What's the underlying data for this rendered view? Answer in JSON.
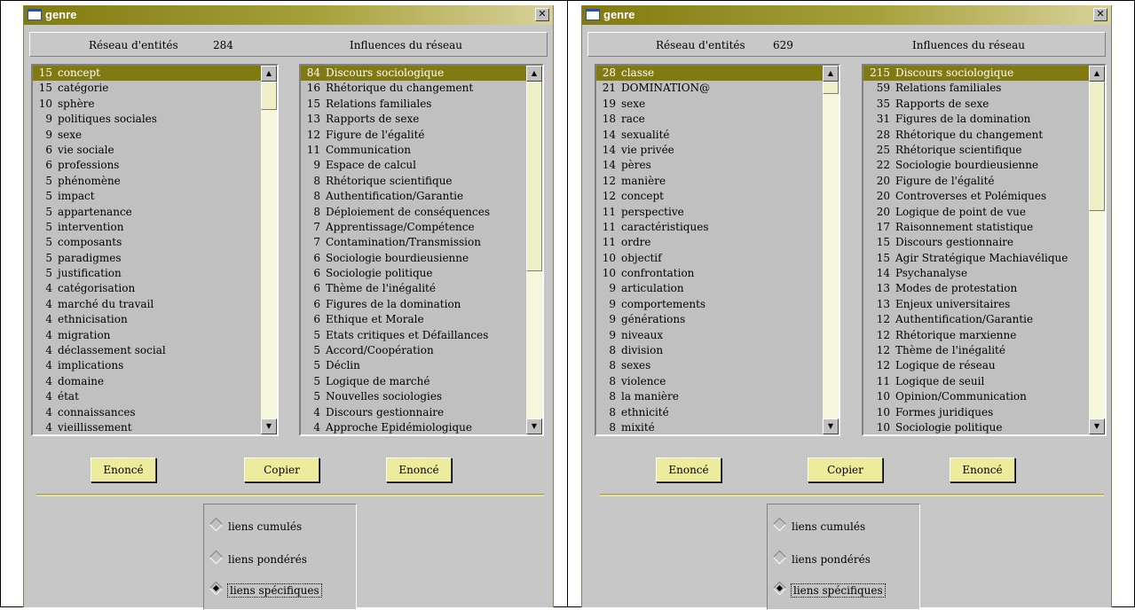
{
  "windows": [
    {
      "title": "genre",
      "close_glyph": "✕",
      "header": {
        "entities_label": "Réseau d'entités",
        "entities_count": "284",
        "influences_label": "Influences du réseau"
      },
      "left_list": [
        {
          "n": "15",
          "t": "concept"
        },
        {
          "n": "15",
          "t": "catégorie"
        },
        {
          "n": "10",
          "t": "sphère"
        },
        {
          "n": "9",
          "t": "politiques sociales"
        },
        {
          "n": "9",
          "t": "sexe"
        },
        {
          "n": "6",
          "t": "vie sociale"
        },
        {
          "n": "6",
          "t": "professions"
        },
        {
          "n": "5",
          "t": "phénomène"
        },
        {
          "n": "5",
          "t": "impact"
        },
        {
          "n": "5",
          "t": "appartenance"
        },
        {
          "n": "5",
          "t": "intervention"
        },
        {
          "n": "5",
          "t": "composants"
        },
        {
          "n": "5",
          "t": "paradigmes"
        },
        {
          "n": "5",
          "t": "justification"
        },
        {
          "n": "4",
          "t": "catégorisation"
        },
        {
          "n": "4",
          "t": "marché du travail"
        },
        {
          "n": "4",
          "t": "ethnicisation"
        },
        {
          "n": "4",
          "t": "migration"
        },
        {
          "n": "4",
          "t": "déclassement social"
        },
        {
          "n": "4",
          "t": "implications"
        },
        {
          "n": "4",
          "t": "domaine"
        },
        {
          "n": "4",
          "t": "état"
        },
        {
          "n": "4",
          "t": "connaissances"
        },
        {
          "n": "4",
          "t": "vieillissement"
        }
      ],
      "right_list": [
        {
          "n": "84",
          "t": "Discours sociologique"
        },
        {
          "n": "16",
          "t": "Rhétorique du changement"
        },
        {
          "n": "15",
          "t": "Relations familiales"
        },
        {
          "n": "13",
          "t": "Rapports de sexe"
        },
        {
          "n": "12",
          "t": "Figure de l'égalité"
        },
        {
          "n": "11",
          "t": "Communication"
        },
        {
          "n": "9",
          "t": "Espace de calcul"
        },
        {
          "n": "8",
          "t": "Rhétorique scientifique"
        },
        {
          "n": "8",
          "t": "Authentification/Garantie"
        },
        {
          "n": "8",
          "t": "Déploiement de conséquences"
        },
        {
          "n": "7",
          "t": "Apprentissage/Compétence"
        },
        {
          "n": "7",
          "t": "Contamination/Transmission"
        },
        {
          "n": "6",
          "t": "Sociologie bourdieusienne"
        },
        {
          "n": "6",
          "t": "Sociologie politique"
        },
        {
          "n": "6",
          "t": "Thème de l'inégalité"
        },
        {
          "n": "6",
          "t": "Figures de la domination"
        },
        {
          "n": "6",
          "t": "Ethique et Morale"
        },
        {
          "n": "5",
          "t": "Etats critiques et Défaillances"
        },
        {
          "n": "5",
          "t": "Accord/Coopération"
        },
        {
          "n": "5",
          "t": "Déclin"
        },
        {
          "n": "5",
          "t": "Logique de marché"
        },
        {
          "n": "5",
          "t": "Nouvelles sociologies"
        },
        {
          "n": "4",
          "t": "Discours gestionnaire"
        },
        {
          "n": "4",
          "t": "Approche Epidémiologique"
        }
      ],
      "buttons": {
        "enonce_left": "Enoncé",
        "copier": "Copier",
        "enonce_right": "Enoncé"
      },
      "radios": [
        {
          "label": "liens cumulés",
          "checked": false
        },
        {
          "label": "liens pondérés",
          "checked": false
        },
        {
          "label": "liens spécifiques",
          "checked": true
        }
      ]
    },
    {
      "title": "genre",
      "close_glyph": "✕",
      "header": {
        "entities_label": "Réseau d'entités",
        "entities_count": "629",
        "influences_label": "Influences du réseau"
      },
      "left_list": [
        {
          "n": "28",
          "t": "classe"
        },
        {
          "n": "21",
          "t": "DOMINATION@"
        },
        {
          "n": "19",
          "t": "sexe"
        },
        {
          "n": "18",
          "t": "race"
        },
        {
          "n": "14",
          "t": "sexualité"
        },
        {
          "n": "14",
          "t": "vie privée"
        },
        {
          "n": "14",
          "t": "pères"
        },
        {
          "n": "12",
          "t": "manière"
        },
        {
          "n": "12",
          "t": "concept"
        },
        {
          "n": "11",
          "t": "perspective"
        },
        {
          "n": "11",
          "t": "caractéristiques"
        },
        {
          "n": "11",
          "t": "ordre"
        },
        {
          "n": "10",
          "t": "objectif"
        },
        {
          "n": "10",
          "t": "confrontation"
        },
        {
          "n": "9",
          "t": "articulation"
        },
        {
          "n": "9",
          "t": "comportements"
        },
        {
          "n": "9",
          "t": "générations"
        },
        {
          "n": "9",
          "t": "niveaux"
        },
        {
          "n": "8",
          "t": "division"
        },
        {
          "n": "8",
          "t": "sexes"
        },
        {
          "n": "8",
          "t": "violence"
        },
        {
          "n": "8",
          "t": "la manière"
        },
        {
          "n": "8",
          "t": "ethnicité"
        },
        {
          "n": "8",
          "t": "mixité"
        }
      ],
      "right_list": [
        {
          "n": "215",
          "t": "Discours sociologique"
        },
        {
          "n": "59",
          "t": "Relations familiales"
        },
        {
          "n": "35",
          "t": "Rapports de sexe"
        },
        {
          "n": "31",
          "t": "Figures de la domination"
        },
        {
          "n": "28",
          "t": "Rhétorique du changement"
        },
        {
          "n": "25",
          "t": "Rhétorique scientifique"
        },
        {
          "n": "22",
          "t": "Sociologie bourdieusienne"
        },
        {
          "n": "20",
          "t": "Figure de l'égalité"
        },
        {
          "n": "20",
          "t": "Controverses et Polémiques"
        },
        {
          "n": "20",
          "t": "Logique de point de vue"
        },
        {
          "n": "17",
          "t": "Raisonnement statistique"
        },
        {
          "n": "15",
          "t": "Discours gestionnaire"
        },
        {
          "n": "15",
          "t": "Agir Stratégique Machiavélique"
        },
        {
          "n": "14",
          "t": "Psychanalyse"
        },
        {
          "n": "13",
          "t": "Modes de protestation"
        },
        {
          "n": "13",
          "t": "Enjeux universitaires"
        },
        {
          "n": "12",
          "t": "Authentification/Garantie"
        },
        {
          "n": "12",
          "t": "Rhétorique marxienne"
        },
        {
          "n": "12",
          "t": "Thème de l'inégalité"
        },
        {
          "n": "12",
          "t": "Logique de réseau"
        },
        {
          "n": "11",
          "t": "Logique de seuil"
        },
        {
          "n": "10",
          "t": "Opinion/Communication"
        },
        {
          "n": "10",
          "t": "Formes juridiques"
        },
        {
          "n": "10",
          "t": "Sociologie politique"
        }
      ],
      "buttons": {
        "enonce_left": "Enoncé",
        "copier": "Copier",
        "enonce_right": "Enoncé"
      },
      "radios": [
        {
          "label": "liens cumulés",
          "checked": false
        },
        {
          "label": "liens pondérés",
          "checked": false
        },
        {
          "label": "liens spécifiques",
          "checked": true
        }
      ]
    }
  ],
  "icons": {
    "scroll_up": "▲",
    "scroll_down": "▼"
  }
}
